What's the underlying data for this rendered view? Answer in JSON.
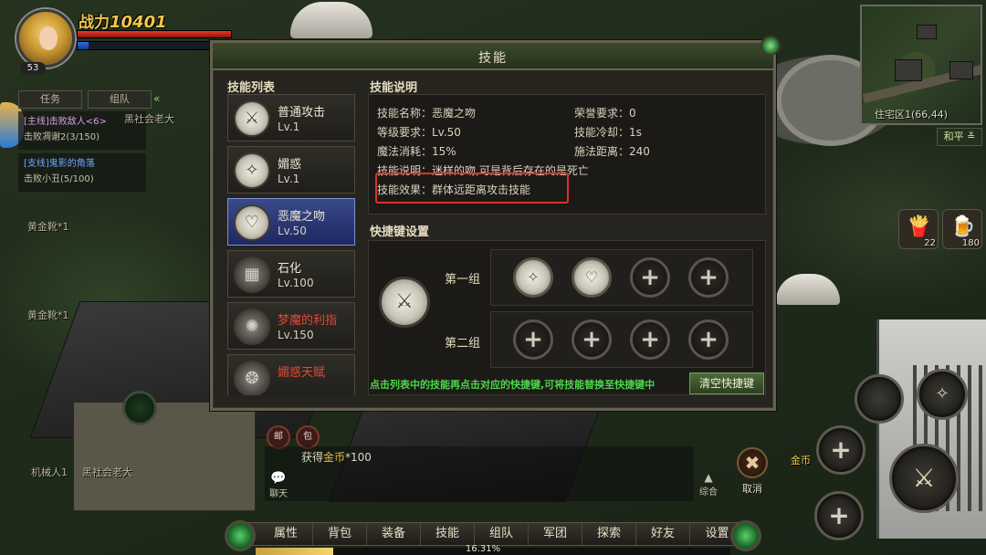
{
  "player": {
    "level": "53",
    "power_label": "战力",
    "power_value": "10401",
    "hp_fill": 1.0,
    "mp_fill": 0.08
  },
  "quest_panel": {
    "tabs": [
      "任务",
      "组队"
    ],
    "items": [
      {
        "title": "[主线]击败敌人<6>",
        "detail": "击败凋谢2(3/150)",
        "type": "main"
      },
      {
        "title": "[支线]鬼影的角落",
        "detail": "击败小丑(5/100)",
        "type": "side"
      }
    ]
  },
  "world_labels": {
    "npc_top": "黑社会老大",
    "drop1": "黄金靴*1",
    "drop2": "黄金靴*1",
    "bottom_left1": "机械人1",
    "bottom_left2": "黑社会老大"
  },
  "minimap": {
    "coord": "住宅区1(66,44)",
    "mode": "和平"
  },
  "items": [
    {
      "icon": "fries-icon",
      "count": "22"
    },
    {
      "icon": "beer-icon",
      "count": "180"
    }
  ],
  "dialog": {
    "title": "技能",
    "skill_list_title": "技能列表",
    "skills": [
      {
        "name": "普通攻击",
        "level": "Lv.1",
        "icon": "sword-icon",
        "selected": false,
        "locked": false
      },
      {
        "name": "媚惑",
        "level": "Lv.1",
        "icon": "sparkle-icon",
        "selected": false,
        "locked": false
      },
      {
        "name": "恶魔之吻",
        "level": "Lv.50",
        "icon": "heart-icon",
        "selected": true,
        "locked": false
      },
      {
        "name": "石化",
        "level": "Lv.100",
        "icon": "grid-icon",
        "selected": false,
        "locked": false
      },
      {
        "name": "梦魔的利指",
        "level": "Lv.150",
        "icon": "claw-icon",
        "selected": false,
        "locked": true
      },
      {
        "name": "媚惑天赋",
        "level": "",
        "icon": "charm-icon",
        "selected": false,
        "locked": true
      }
    ],
    "desc_title": "技能说明",
    "desc": {
      "name": "技能名称：恶魔之吻",
      "honor": "荣誉要求：0",
      "level_req": "等级要求：Lv.50",
      "cooldown": "技能冷却：1s",
      "mana": "魔法消耗：15%",
      "range": "施法距离：240",
      "explain": "技能说明：迷样的吻,可是背后存在的是死亡",
      "effect": "技能效果：群体远距离攻击技能"
    },
    "hotkey_title": "快捷键设置",
    "groups": [
      {
        "label": "第一组",
        "slots": [
          "sparkle-icon",
          "heart-icon",
          "",
          ""
        ]
      },
      {
        "label": "第二组",
        "slots": [
          "",
          "",
          "",
          ""
        ]
      }
    ],
    "hint": "点击列表中的技能再点击对应的快捷键,可将技能替换至快捷键中",
    "clear_button": "清空快捷键"
  },
  "chat": {
    "mail_label": "邮",
    "bag_label": "包",
    "message_prefix": "获得",
    "message_gold": "金币",
    "message_suffix": "*100",
    "chat_button": "聊天",
    "collapse_button": "综合",
    "cancel_label": "取消",
    "gold_label": "金币"
  },
  "bottom_menu": [
    "属性",
    "背包",
    "装备",
    "技能",
    "组队",
    "军团",
    "探索",
    "好友",
    "设置"
  ],
  "xp": {
    "percent_text": "16.31%",
    "fill": 0.1631
  }
}
